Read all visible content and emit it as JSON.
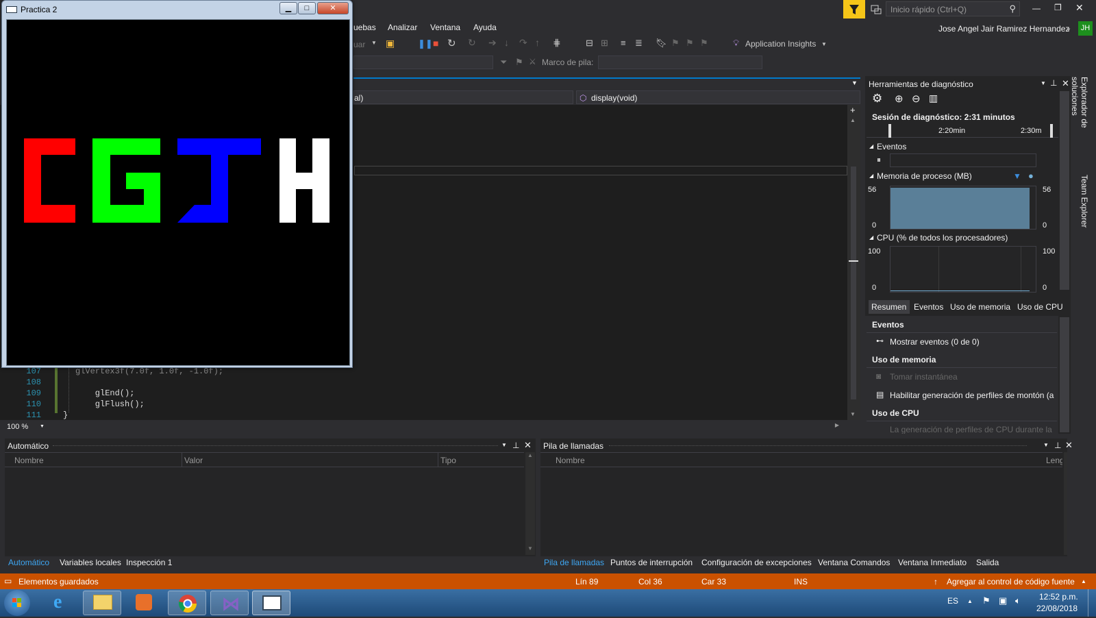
{
  "glwindow": {
    "title": "Practica 2",
    "min": "0",
    "max": "1",
    "close": "x"
  },
  "menu": [
    "uebas",
    "Analizar",
    "Ventana",
    "Ayuda"
  ],
  "quick_launch": {
    "placeholder": "Inicio rápido (Ctrl+Q)"
  },
  "user": {
    "name": "Jose Angel Jair Ramirez Hernandez",
    "initials": "JH"
  },
  "toolbar": {
    "debug_label": "uar",
    "app_insights": "Application Insights",
    "stack_frame_label": "Marco de pila:"
  },
  "editor": {
    "scope_left": "al)",
    "scope_right": "display(void)",
    "lines": [
      {
        "num": "107",
        "code": "    glVertex3f(7.0f, 1.0f, -1.0f);"
      },
      {
        "num": "108",
        "code": ""
      },
      {
        "num": "109",
        "code": "    glEnd();"
      },
      {
        "num": "110",
        "code": "    glFlush();"
      },
      {
        "num": "111",
        "code": "}"
      }
    ],
    "zoom": "100 %"
  },
  "diagnostics": {
    "title": "Herramientas de diagnóstico",
    "session": "Sesión de diagnóstico: 2:31 minutos",
    "tick1": "2:20min",
    "tick2": "2:30m",
    "events_label": "Eventos",
    "memory_label": "Memoria de proceso (MB)",
    "mem_max": "56",
    "mem_min": "0",
    "cpu_label": "CPU (% de todos los procesadores)",
    "cpu_max": "100",
    "cpu_min": "0",
    "tabs": [
      "Resumen",
      "Eventos",
      "Uso de memoria",
      "Uso de CPU"
    ],
    "summary": {
      "events_head": "Eventos",
      "show_events": "Mostrar eventos (0 de 0)",
      "memory_head": "Uso de memoria",
      "snapshot": "Tomar instantánea",
      "heap": "Habilitar generación de perfiles de montón (a",
      "cpu_head": "Uso de CPU",
      "cpu_note": "La generación de perfiles de CPU durante la d"
    }
  },
  "side_tabs": [
    "Explorador de soluciones",
    "Team Explorer"
  ],
  "auto_panel": {
    "title": "Automático",
    "cols": [
      "Nombre",
      "Valor",
      "Tipo"
    ]
  },
  "call_panel": {
    "title": "Pila de llamadas",
    "cols": [
      "Nombre",
      "Leng"
    ]
  },
  "bottom_tabs_left": [
    "Automático",
    "Variables locales",
    "Inspección 1"
  ],
  "bottom_tabs_right": [
    "Pila de llamadas",
    "Puntos de interrupción",
    "Configuración de excepciones",
    "Ventana Comandos",
    "Ventana Inmediato",
    "Salida"
  ],
  "status": {
    "message": "Elementos guardados",
    "line": "Lín 89",
    "col": "Col 36",
    "car": "Car 33",
    "ins": "INS",
    "source": "Agregar al control de código fuente"
  },
  "taskbar": {
    "lang": "ES",
    "time": "12:52 p.m.",
    "date": "22/08/2018"
  },
  "colors": {
    "accent": "#007acc",
    "status": "#ca5100",
    "red": "#ff0000",
    "green": "#00ff00",
    "blue": "#0000ff",
    "white": "#ffffff"
  }
}
